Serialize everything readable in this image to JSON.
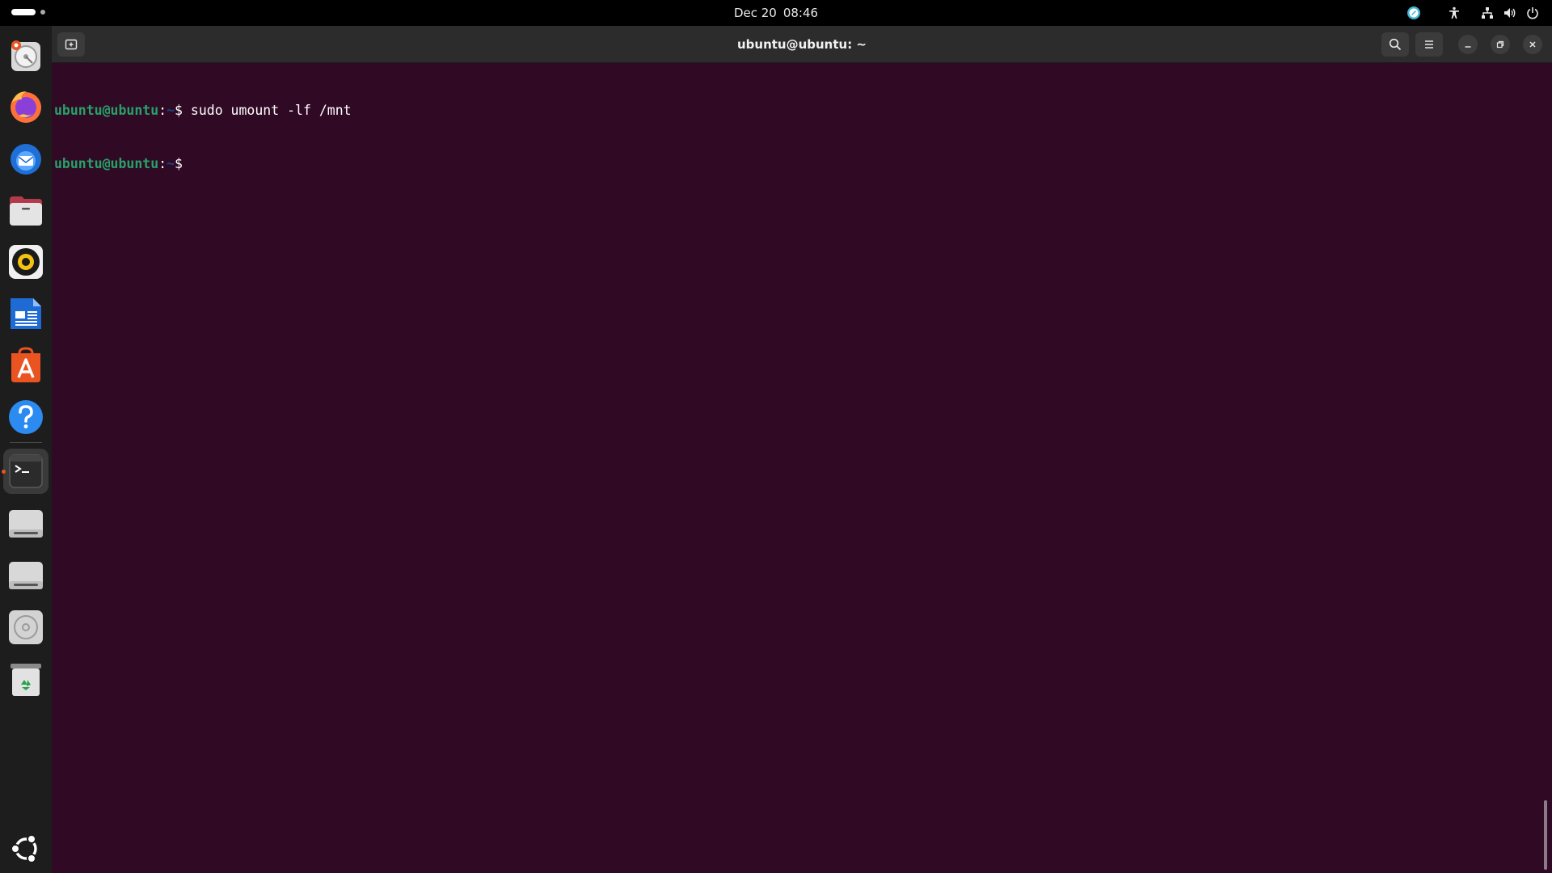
{
  "topbar": {
    "date": "Dec 20",
    "time": "08:46",
    "tray_icons": [
      "copilot-icon",
      "accessibility-icon",
      "network-icon",
      "volume-icon",
      "power-icon"
    ]
  },
  "dock": {
    "items": [
      {
        "name": "disk-utility-icon"
      },
      {
        "name": "firefox-icon"
      },
      {
        "name": "thunderbird-icon"
      },
      {
        "name": "files-icon"
      },
      {
        "name": "rhythmbox-icon"
      },
      {
        "name": "libreoffice-writer-icon"
      },
      {
        "name": "app-center-icon"
      },
      {
        "name": "help-icon"
      },
      {
        "name": "terminal-icon",
        "active": true
      },
      {
        "name": "drive-icon"
      },
      {
        "name": "drive-icon"
      },
      {
        "name": "optical-drive-icon"
      },
      {
        "name": "trash-icon"
      }
    ],
    "show_apps_icon": "ubuntu-logo-icon"
  },
  "window": {
    "title": "ubuntu@ubuntu: ~",
    "new_tab_icon": "new-tab-icon",
    "search_icon": "search-icon",
    "menu_icon": "hamburger-menu-icon"
  },
  "terminal": {
    "lines": [
      {
        "user": "ubuntu@ubuntu",
        "colon": ":",
        "path": "~",
        "dollar": "$",
        "command": " sudo umount -lf /mnt"
      },
      {
        "user": "ubuntu@ubuntu",
        "colon": ":",
        "path": "~",
        "dollar": "$",
        "command": " "
      }
    ]
  },
  "colors": {
    "terminal_bg": "#300a24",
    "prompt_user": "#26a269",
    "prompt_path": "#12488b",
    "accent": "#e95420"
  }
}
